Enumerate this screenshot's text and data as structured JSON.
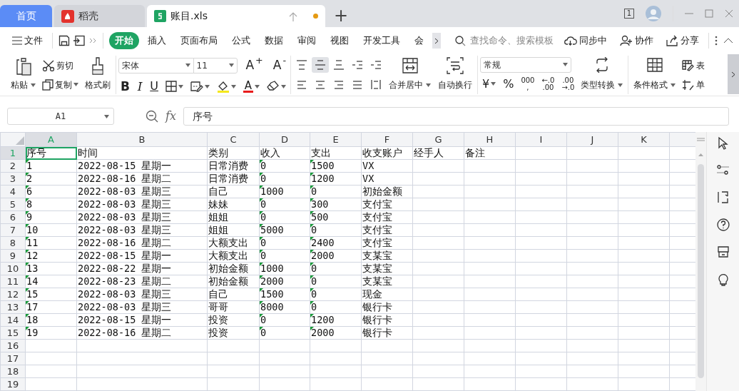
{
  "app_tabs": [
    {
      "kind": "home",
      "label": "首页",
      "selected": false,
      "modified": false
    },
    {
      "kind": "app",
      "label": "稻壳",
      "selected": false,
      "modified": false
    },
    {
      "kind": "sheet",
      "label": "账目.xls",
      "selected": true,
      "modified": true
    }
  ],
  "new_tab": "+",
  "window_count": "1",
  "file_menu": "文件",
  "menu_tabs": [
    {
      "label": "开始",
      "selected": true
    },
    {
      "label": "插入",
      "selected": false
    },
    {
      "label": "页面布局",
      "selected": false
    },
    {
      "label": "公式",
      "selected": false
    },
    {
      "label": "数据",
      "selected": false
    },
    {
      "label": "审阅",
      "selected": false
    },
    {
      "label": "视图",
      "selected": false
    },
    {
      "label": "开发工具",
      "selected": false
    },
    {
      "label": "会",
      "selected": false
    }
  ],
  "search": {
    "placeholder": "查找命令、搜索模板"
  },
  "actions": [
    {
      "kind": "sync",
      "label": "同步中"
    },
    {
      "kind": "collab",
      "label": "协作"
    },
    {
      "kind": "share",
      "label": "分享"
    }
  ],
  "clipboard": {
    "paste": "粘贴",
    "cut": "剪切",
    "copy": "复制",
    "format_painter": "格式刷"
  },
  "font": {
    "name": "宋体",
    "size": "11",
    "grow": "A$^{+}$",
    "shrink": "A$^{-}$",
    "bold": "B",
    "italic": "I",
    "underline": "U",
    "font_color": "A"
  },
  "align_buttons": [
    {
      "kind": "top",
      "selected": false
    },
    {
      "kind": "middle",
      "selected": true
    },
    {
      "kind": "bottom",
      "selected": false
    },
    {
      "kind": "outdent",
      "selected": false
    },
    {
      "kind": "indent",
      "selected": false
    },
    {
      "kind": "left",
      "selected": false
    },
    {
      "kind": "center",
      "selected": false
    },
    {
      "kind": "right",
      "selected": false
    },
    {
      "kind": "justify",
      "selected": false
    },
    {
      "kind": "distribute",
      "selected": false
    }
  ],
  "merge": "合并居中",
  "wrap": "自动换行",
  "number": {
    "format": "常规",
    "currency": "¥",
    "percent": "%",
    "thousands": [
      "000",
      ","
    ],
    "add_decimal": [
      "←.0",
      ".00"
    ],
    "remove_decimal": [
      ".00",
      "→.0"
    ],
    "convert": "类型转换"
  },
  "styles": {
    "conditional": "条件格式",
    "table": "表",
    "cell": "单"
  },
  "formula_bar": {
    "cell_ref": "A1",
    "fx": "fx",
    "value": "序号"
  },
  "columns": [
    {
      "letter": "A",
      "selected": true,
      "text_marker": true
    },
    {
      "letter": "B",
      "selected": false,
      "text_marker": false
    },
    {
      "letter": "C",
      "selected": false,
      "text_marker": false
    },
    {
      "letter": "D",
      "selected": false,
      "text_marker": true
    },
    {
      "letter": "E",
      "selected": false,
      "text_marker": true
    },
    {
      "letter": "F",
      "selected": false,
      "text_marker": false
    },
    {
      "letter": "G",
      "selected": false,
      "text_marker": false
    },
    {
      "letter": "H",
      "selected": false,
      "text_marker": false
    },
    {
      "letter": "I",
      "selected": false,
      "text_marker": false
    },
    {
      "letter": "J",
      "selected": false,
      "text_marker": false
    },
    {
      "letter": "K",
      "selected": false,
      "text_marker": false
    }
  ],
  "rows": [
    {
      "number": "1",
      "selected": true,
      "cells": [
        "序号",
        "时间",
        "类别",
        "收入",
        "支出",
        "收支账户",
        "经手人",
        "备注"
      ]
    },
    {
      "number": "2",
      "selected": false,
      "cells": [
        "1",
        "2022-08-15 星期一",
        "日常消费",
        "0",
        "1500",
        "VX"
      ]
    },
    {
      "number": "3",
      "selected": false,
      "cells": [
        "2",
        "2022-08-16 星期二",
        "日常消费",
        "0",
        "1200",
        "VX"
      ]
    },
    {
      "number": "4",
      "selected": false,
      "cells": [
        "6",
        "2022-08-03 星期三",
        "自己",
        "1000",
        "0",
        "初始金额"
      ]
    },
    {
      "number": "5",
      "selected": false,
      "cells": [
        "8",
        "2022-08-03 星期三",
        "妹妹",
        "0",
        "300",
        "支付宝"
      ]
    },
    {
      "number": "6",
      "selected": false,
      "cells": [
        "9",
        "2022-08-03 星期三",
        "姐姐",
        "0",
        "500",
        "支付宝"
      ]
    },
    {
      "number": "7",
      "selected": false,
      "cells": [
        "10",
        "2022-08-03 星期三",
        "姐姐",
        "5000",
        "0",
        "支付宝"
      ]
    },
    {
      "number": "8",
      "selected": false,
      "cells": [
        "11",
        "2022-08-16 星期二",
        "大额支出",
        "0",
        "2400",
        "支付宝"
      ]
    },
    {
      "number": "9",
      "selected": false,
      "cells": [
        "12",
        "2022-08-15 星期一",
        "大额支出",
        "0",
        "2000",
        "支某宝"
      ]
    },
    {
      "number": "10",
      "selected": false,
      "cells": [
        "13",
        "2022-08-22 星期一",
        "初始金额",
        "1000",
        "0",
        "支某宝"
      ]
    },
    {
      "number": "11",
      "selected": false,
      "cells": [
        "14",
        "2022-08-23 星期二",
        "初始金额",
        "2000",
        "0",
        "支某宝"
      ]
    },
    {
      "number": "12",
      "selected": false,
      "cells": [
        "15",
        "2022-08-03 星期三",
        "自己",
        "1500",
        "0",
        "现金"
      ]
    },
    {
      "number": "13",
      "selected": false,
      "cells": [
        "17",
        "2022-08-03 星期三",
        "哥哥",
        "8000",
        "0",
        "银行卡"
      ]
    },
    {
      "number": "14",
      "selected": false,
      "cells": [
        "18",
        "2022-08-15 星期一",
        "投资",
        "0",
        "1200",
        "银行卡"
      ]
    },
    {
      "number": "15",
      "selected": false,
      "cells": [
        "19",
        "2022-08-16 星期二",
        "投资",
        "0",
        "2000",
        "银行卡"
      ]
    },
    {
      "number": "16",
      "selected": false
    },
    {
      "number": "17",
      "selected": false
    },
    {
      "number": "18",
      "selected": false
    },
    {
      "number": "19",
      "selected": false
    }
  ]
}
